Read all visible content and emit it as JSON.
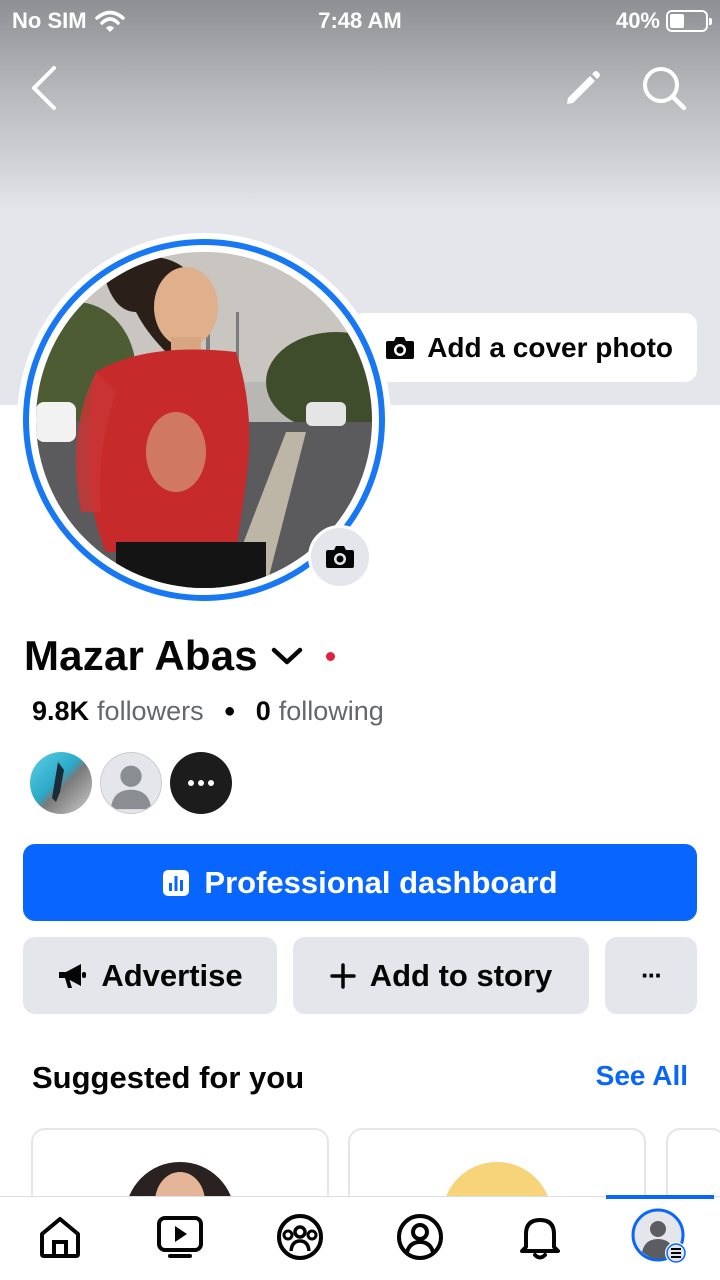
{
  "status_bar": {
    "carrier": "No SIM",
    "time": "7:48 AM",
    "battery": "40%",
    "battery_level": 0.4
  },
  "cover": {
    "add_cover_label": "Add a cover photo"
  },
  "profile": {
    "name": "Mazar Abas",
    "followers_count": "9.8K",
    "followers_label": "followers",
    "following_count": "0",
    "following_label": "following"
  },
  "buttons": {
    "professional_dashboard": "Professional dashboard",
    "advertise": "Advertise",
    "add_to_story": "Add to story",
    "more": "···"
  },
  "suggested": {
    "title": "Suggested for you",
    "see_all": "See All"
  },
  "tabs": [
    "home-icon",
    "video-icon",
    "groups-icon",
    "profile-icon",
    "notifications-icon",
    "menu-icon"
  ],
  "colors": {
    "accent": "#0866ff",
    "ring": "#1877f2",
    "button_gray": "#e4e6eb",
    "online_dot": "#e41e3f"
  }
}
